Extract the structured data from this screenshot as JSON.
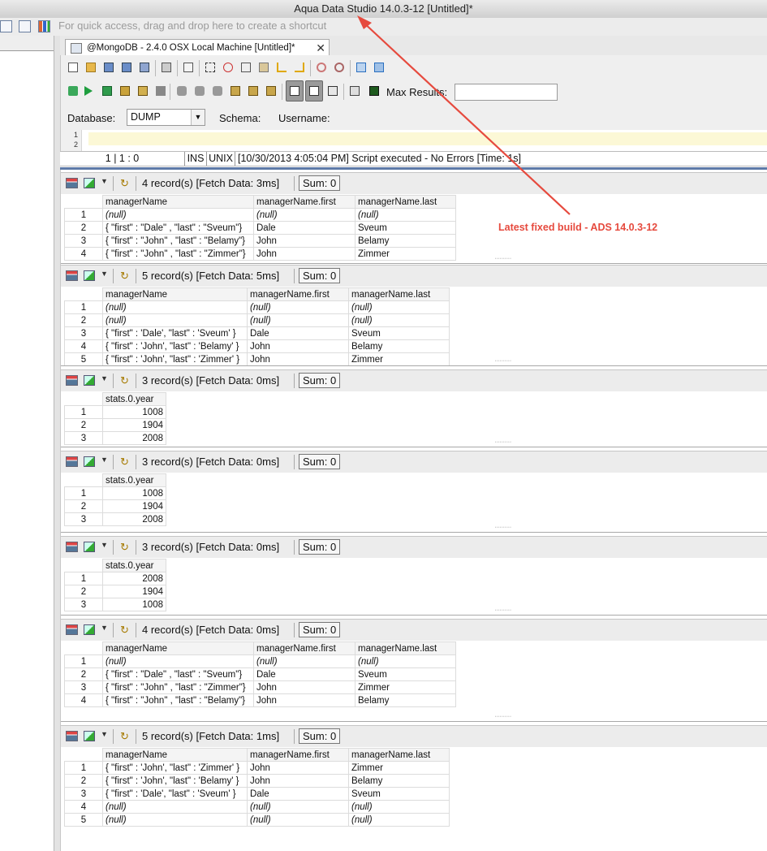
{
  "window": {
    "title": "Aqua Data Studio 14.0.3-12 [Untitled]*"
  },
  "shortcut_bar": {
    "hint": "For quick access, drag and drop here to create a shortcut"
  },
  "tab": {
    "label": "@MongoDB - 2.4.0 OSX Local Machine [Untitled]*",
    "close": "✕"
  },
  "toolbar": {
    "max_results_label": "Max Results:",
    "max_results_value": "",
    "database_label": "Database:",
    "database_value": "DUMP",
    "schema_label": "Schema:",
    "username_label": "Username:"
  },
  "editor": {
    "line_numbers": "1\n2"
  },
  "status": {
    "position": "1 | 1 : 0",
    "mode": "INS",
    "line_ending": "UNIX",
    "message": "[10/30/2013 4:05:04 PM] Script executed - No Errors [Time: 1s]"
  },
  "annotation": {
    "text": "Latest fixed build - ADS 14.0.3-12",
    "color": "#e64a3e"
  },
  "results": [
    {
      "records": "4 record(s) [Fetch Data: 3ms]",
      "sum": "Sum: 0",
      "columns": [
        "managerName",
        "managerName.first",
        "managerName.last"
      ],
      "rows": [
        [
          "1",
          "(null)",
          "(null)",
          "(null)"
        ],
        [
          "2",
          "{ \"first\" : \"Dale\" , \"last\" : \"Sveum\"}",
          "Dale",
          "Sveum"
        ],
        [
          "3",
          "{ \"first\" : \"John\" , \"last\" : \"Belamy\"}",
          "John",
          "Belamy"
        ],
        [
          "4",
          "{ \"first\" : \"John\" , \"last\" : \"Zimmer\"}",
          "John",
          "Zimmer"
        ]
      ]
    },
    {
      "records": "5 record(s) [Fetch Data: 5ms]",
      "sum": "Sum: 0",
      "columns": [
        "managerName",
        "managerName.first",
        "managerName.last"
      ],
      "rows": [
        [
          "1",
          "(null)",
          "(null)",
          "(null)"
        ],
        [
          "2",
          "(null)",
          "(null)",
          "(null)"
        ],
        [
          "3",
          "{ \"first\" : 'Dale', \"last\" : 'Sveum' }",
          "Dale",
          "Sveum"
        ],
        [
          "4",
          "{ \"first\" : 'John', \"last\" : 'Belamy' }",
          "John",
          "Belamy"
        ],
        [
          "5",
          "{ \"first\" : 'John', \"last\" : 'Zimmer' }",
          "John",
          "Zimmer"
        ]
      ]
    },
    {
      "records": "3 record(s) [Fetch Data: 0ms]",
      "sum": "Sum: 0",
      "columns": [
        "stats.0.year"
      ],
      "rows": [
        [
          "1",
          "1008"
        ],
        [
          "2",
          "1904"
        ],
        [
          "3",
          "2008"
        ]
      ]
    },
    {
      "records": "3 record(s) [Fetch Data: 0ms]",
      "sum": "Sum: 0",
      "columns": [
        "stats.0.year"
      ],
      "rows": [
        [
          "1",
          "1008"
        ],
        [
          "2",
          "1904"
        ],
        [
          "3",
          "2008"
        ]
      ]
    },
    {
      "records": "3 record(s) [Fetch Data: 0ms]",
      "sum": "Sum: 0",
      "columns": [
        "stats.0.year"
      ],
      "rows": [
        [
          "1",
          "2008"
        ],
        [
          "2",
          "1904"
        ],
        [
          "3",
          "1008"
        ]
      ]
    },
    {
      "records": "4 record(s) [Fetch Data: 0ms]",
      "sum": "Sum: 0",
      "columns": [
        "managerName",
        "managerName.first",
        "managerName.last"
      ],
      "rows": [
        [
          "1",
          "(null)",
          "(null)",
          "(null)"
        ],
        [
          "2",
          "{ \"first\" : \"Dale\" , \"last\" : \"Sveum\"}",
          "Dale",
          "Sveum"
        ],
        [
          "3",
          "{ \"first\" : \"John\" , \"last\" : \"Zimmer\"}",
          "John",
          "Zimmer"
        ],
        [
          "4",
          "{ \"first\" : \"John\" , \"last\" : \"Belamy\"}",
          "John",
          "Belamy"
        ]
      ]
    },
    {
      "records": "5 record(s) [Fetch Data: 1ms]",
      "sum": "Sum: 0",
      "columns": [
        "managerName",
        "managerName.first",
        "managerName.last"
      ],
      "rows": [
        [
          "1",
          "{ \"first\" : 'John', \"last\" : 'Zimmer' }",
          "John",
          "Zimmer"
        ],
        [
          "2",
          "{ \"first\" : 'John', \"last\" : 'Belamy' }",
          "John",
          "Belamy"
        ],
        [
          "3",
          "{ \"first\" : 'Dale', \"last\" : 'Sveum' }",
          "Dale",
          "Sveum"
        ],
        [
          "4",
          "(null)",
          "(null)",
          "(null)"
        ],
        [
          "5",
          "(null)",
          "(null)",
          "(null)"
        ]
      ]
    }
  ]
}
